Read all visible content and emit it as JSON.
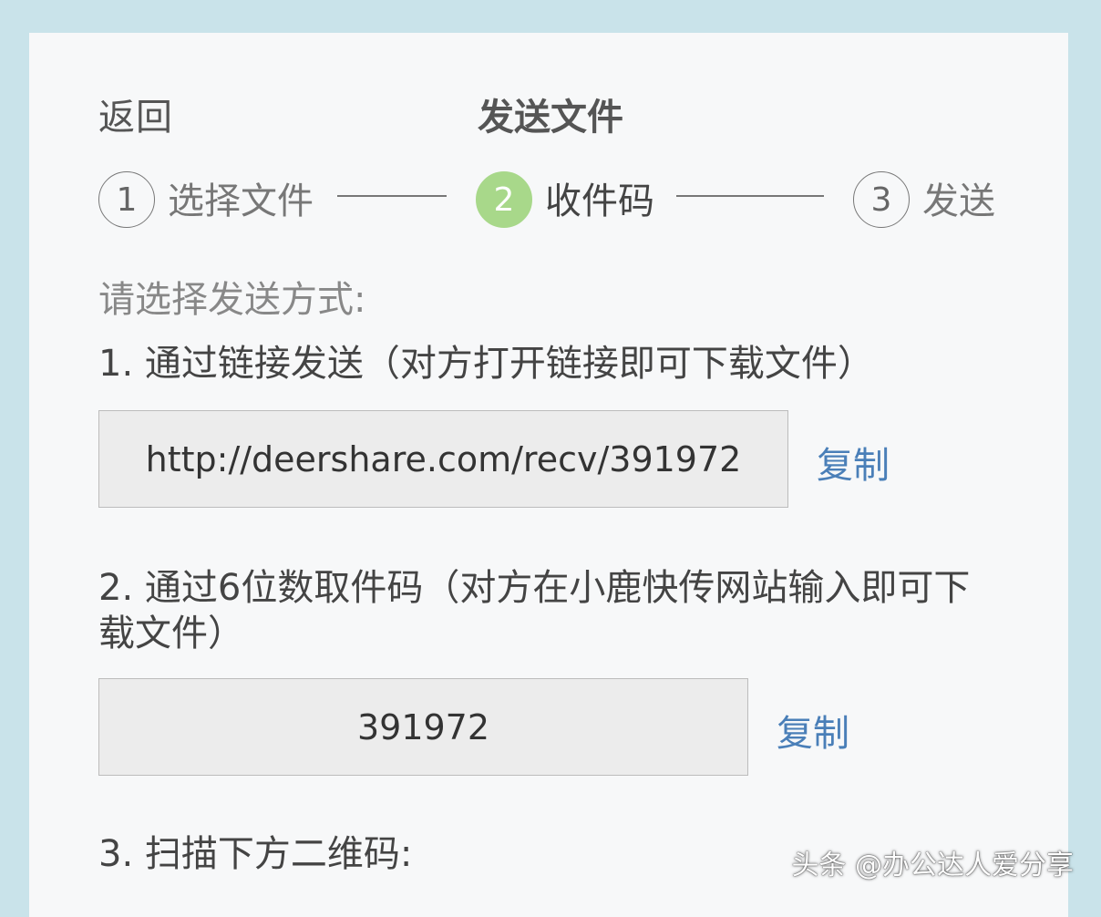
{
  "header": {
    "back_label": "返回",
    "title": "发送文件"
  },
  "steps": [
    {
      "number": "1",
      "label": "选择文件",
      "state": "done"
    },
    {
      "number": "2",
      "label": "收件码",
      "state": "active"
    },
    {
      "number": "3",
      "label": "发送",
      "state": "pending"
    }
  ],
  "prompt": "请选择发送方式:",
  "option_link": {
    "heading": "1. 通过链接发送（对方打开链接即可下载文件）",
    "value": "http://deershare.com/recv/391972",
    "copy_label": "复制"
  },
  "option_code": {
    "heading": "2. 通过6位数取件码（对方在小鹿快传网站输入即可下载文件）",
    "value": "391972",
    "copy_label": "复制"
  },
  "option_qr": {
    "heading": "3. 扫描下方二维码:"
  },
  "watermark": "头条 @办公达人爱分享",
  "colors": {
    "active_step": "#a8d88a",
    "link": "#4a7fb8",
    "background": "#c9e3ea"
  }
}
